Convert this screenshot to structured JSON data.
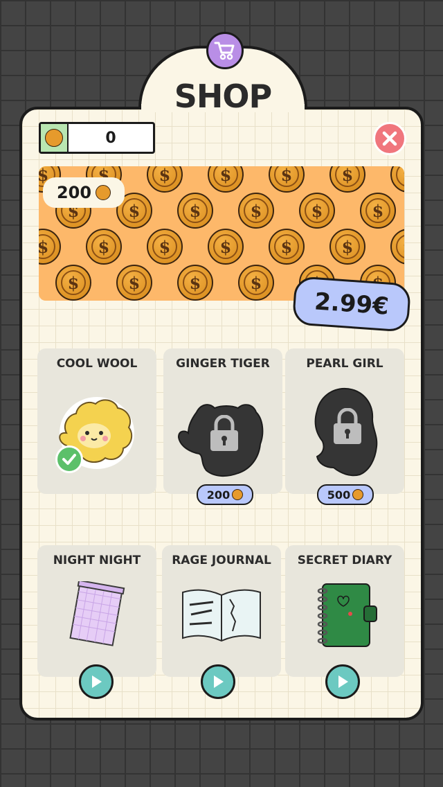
{
  "header": {
    "title": "SHOP"
  },
  "balance": {
    "value": "0"
  },
  "bundle": {
    "amount": "200",
    "price": "2.99€"
  },
  "items": [
    {
      "name": "COOL WOOL",
      "state": "owned"
    },
    {
      "name": "GINGER TIGER",
      "state": "locked",
      "cost": "200"
    },
    {
      "name": "PEARL GIRL",
      "state": "locked",
      "cost": "500"
    },
    {
      "name": "NIGHT NIGHT",
      "state": "play"
    },
    {
      "name": "RAGE JOURNAL",
      "state": "play"
    },
    {
      "name": "SECRET DIARY",
      "state": "play"
    }
  ],
  "colors": {
    "panel": "#fbf6e6",
    "cart": "#b98ee6",
    "close": "#f0767d",
    "banner": "#fdb86a",
    "price": "#b9c8fb",
    "play": "#6cc9c1",
    "check": "#5cc06a"
  },
  "icons": [
    "cart-icon",
    "coin-icon",
    "close-icon",
    "lock-icon",
    "check-icon",
    "play-icon"
  ]
}
